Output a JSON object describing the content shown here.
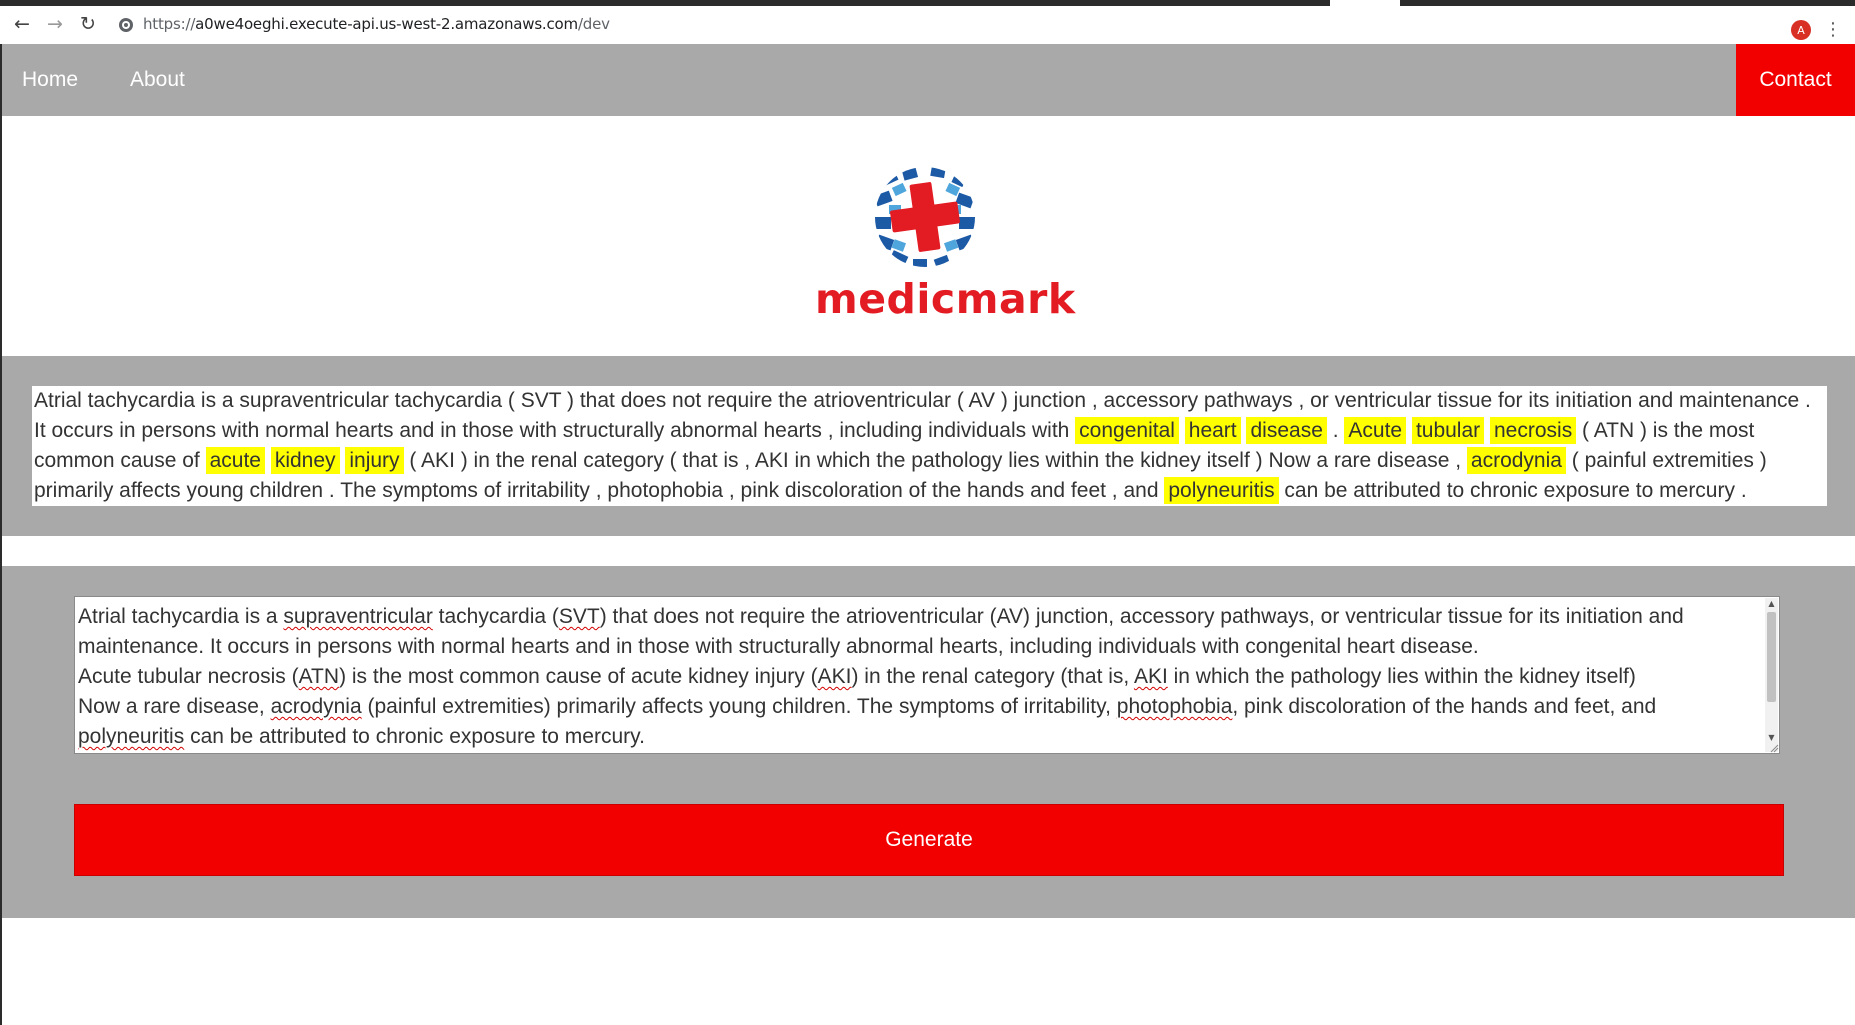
{
  "browser": {
    "url_scheme": "https://",
    "url_host": "a0we4oeghi.execute-api.us-west-2.amazonaws.com",
    "url_path": "/dev",
    "profile_initial": "A",
    "icons": [
      "back-arrow-icon",
      "forward-arrow-icon",
      "reload-icon",
      "site-info-icon",
      "menu-kebab-icon"
    ]
  },
  "nav": {
    "home": "Home",
    "about": "About",
    "contact": "Contact"
  },
  "logo": {
    "brand": "medicmark",
    "icon": "globe-with-red-cross"
  },
  "annotated": {
    "segments": [
      {
        "t": "Atrial tachycardia is a supraventricular tachycardia ( SVT ) that does not require the atrioventricular ( AV ) junction , accessory pathways , or ventricular tissue for its initiation and maintenance . It occurs in persons with normal hearts and in those with structurally abnormal hearts , including individuals with ",
        "h": false
      },
      {
        "t": "congenital",
        "h": true
      },
      {
        "t": " ",
        "h": false
      },
      {
        "t": "heart",
        "h": true
      },
      {
        "t": " ",
        "h": false
      },
      {
        "t": "disease",
        "h": true
      },
      {
        "t": " . ",
        "h": false
      },
      {
        "t": "Acute",
        "h": true
      },
      {
        "t": " ",
        "h": false
      },
      {
        "t": "tubular",
        "h": true
      },
      {
        "t": " ",
        "h": false
      },
      {
        "t": "necrosis",
        "h": true
      },
      {
        "t": " ( ATN ) is the most common cause of ",
        "h": false
      },
      {
        "t": "acute",
        "h": true
      },
      {
        "t": " ",
        "h": false
      },
      {
        "t": "kidney",
        "h": true
      },
      {
        "t": " ",
        "h": false
      },
      {
        "t": "injury",
        "h": true
      },
      {
        "t": " ( AKI ) in the renal category ( that is , AKI in which the pathology lies within the kidney itself ) Now a rare disease , ",
        "h": false
      },
      {
        "t": "acrodynia",
        "h": true
      },
      {
        "t": " ( painful extremities ) primarily affects young children . The symptoms of irritability , photophobia , pink discoloration of the hands and feet , and ",
        "h": false
      },
      {
        "t": "polyneuritis",
        "h": true
      },
      {
        "t": " can be attributed to chronic exposure to mercury .",
        "h": false
      }
    ],
    "highlight_color": "#ffff00"
  },
  "input": {
    "lines": [
      [
        {
          "t": "Atrial tachycardia is a ",
          "sq": false
        },
        {
          "t": "supraventricular",
          "sq": true
        },
        {
          "t": " tachycardia (",
          "sq": false
        },
        {
          "t": "SVT",
          "sq": true
        },
        {
          "t": ") that does not require the atrioventricular (AV) junction, accessory pathways, or ventricular tissue for its initiation and maintenance. It occurs in persons with normal hearts and in those with structurally abnormal hearts, including individuals with congenital heart disease.",
          "sq": false
        }
      ],
      [
        {
          "t": "Acute tubular necrosis (",
          "sq": false
        },
        {
          "t": "ATN",
          "sq": true
        },
        {
          "t": ") is the most common cause of acute kidney injury (",
          "sq": false
        },
        {
          "t": "AKI",
          "sq": true
        },
        {
          "t": ") in the renal category (that is, ",
          "sq": false
        },
        {
          "t": "AKI",
          "sq": true
        },
        {
          "t": " in which the pathology lies within the kidney itself)",
          "sq": false
        }
      ],
      [
        {
          "t": "Now a rare disease, ",
          "sq": false
        },
        {
          "t": "acrodynia",
          "sq": true
        },
        {
          "t": " (painful extremities) primarily affects young children. The symptoms of irritability, ",
          "sq": false
        },
        {
          "t": "photophobia",
          "sq": true
        },
        {
          "t": ", pink discoloration of the hands and feet, and ",
          "sq": false
        },
        {
          "t": "polyneuritis",
          "sq": true
        },
        {
          "t": " can be attributed to chronic exposure to mercury.",
          "sq": false
        }
      ]
    ]
  },
  "actions": {
    "generate": "Generate"
  },
  "colors": {
    "nav_bg": "#a9a9a9",
    "accent_red": "#f20000",
    "brand_red": "#e31b23",
    "brand_blue": "#1c5aa6"
  }
}
